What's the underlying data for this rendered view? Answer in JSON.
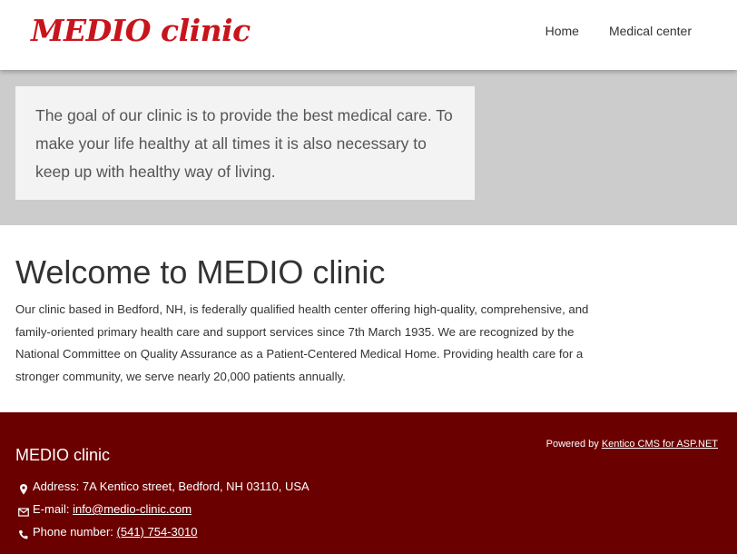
{
  "header": {
    "logo": "MEDIO clinic",
    "nav": [
      "Home",
      "Medical center"
    ]
  },
  "hero": {
    "text": "The goal of our clinic is to provide the best medical care. To make your life healthy at all times it is also necessary to keep up with healthy way of living."
  },
  "main": {
    "title": "Welcome to MEDIO clinic",
    "paragraph": "Our clinic based in Bedford, NH, is federally qualified health center offering high-quality, comprehensive, and family-oriented primary health care and support services since 7th March 1935. We are recognized by the National Committee on Quality Assurance as a Patient-Centered Medical Home. Providing health care for a stronger community, we serve nearly 20,000 patients annually."
  },
  "footer": {
    "title": "MEDIO clinic",
    "address": "Address: 7A Kentico street, Bedford, NH 03110, USA",
    "email_label": "E-mail:",
    "email": "info@medio-clinic.com",
    "phone_label": "Phone number:",
    "phone": "(541) 754-3010",
    "powered_by_label": "Powered by",
    "powered_by_link": "Kentico CMS for ASP.NET",
    "icons": [
      "map-marker-icon",
      "envelope-icon",
      "phone-icon"
    ]
  },
  "colors": {
    "brand_red": "#c8141c",
    "hero_band": "#cccccc",
    "hero_box": "#f3f3f3",
    "footer_bg": "#6b0000"
  }
}
